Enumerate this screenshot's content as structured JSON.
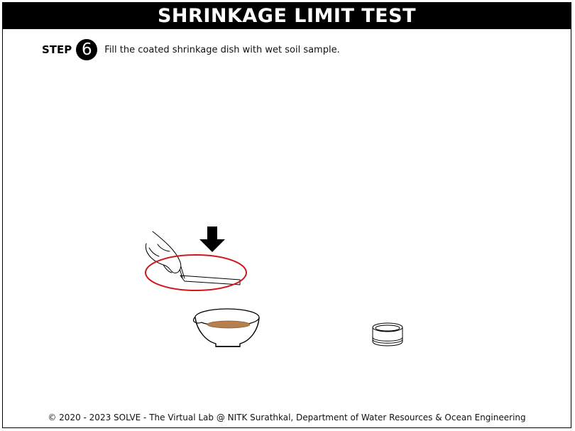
{
  "header": {
    "title": "SHRINKAGE LIMIT TEST"
  },
  "step": {
    "label": "STEP",
    "number": "6",
    "instruction": "Fill the coated shrinkage dish with wet soil sample."
  },
  "scene": {
    "items": [
      "hand-with-spatula-icon",
      "down-arrow-icon",
      "red-highlight-ellipse",
      "mixing-bowl-with-soil-icon",
      "shrinkage-dish-icon"
    ],
    "colors": {
      "highlight": "#d0171d",
      "soil": "#b67f50",
      "outline": "#000000"
    }
  },
  "footer": {
    "copyright": "© 2020 - 2023 SOLVE - The Virtual Lab @ NITK Surathkal, Department of Water Resources & Ocean Engineering"
  }
}
